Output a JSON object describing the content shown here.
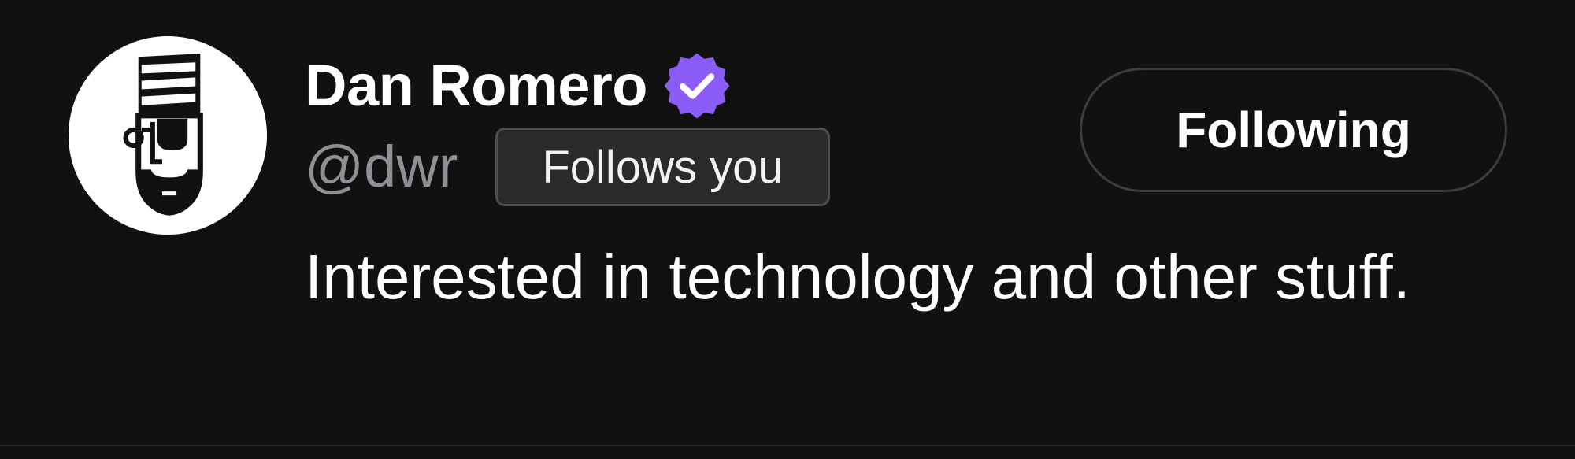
{
  "profile": {
    "display_name": "Dan Romero",
    "handle": "@dwr",
    "follows_you_label": "Follows you",
    "bio": "Interested in technology and other stuff.",
    "avatar_icon": "pirate-face-avatar",
    "verified_icon": "verified-badge-icon"
  },
  "actions": {
    "follow_state_label": "Following"
  },
  "colors": {
    "background": "#111112",
    "verified_badge": "#8b5cf6",
    "handle_text": "#8f8f95",
    "badge_background": "#2b2b2d",
    "button_border": "#3d3d40"
  }
}
